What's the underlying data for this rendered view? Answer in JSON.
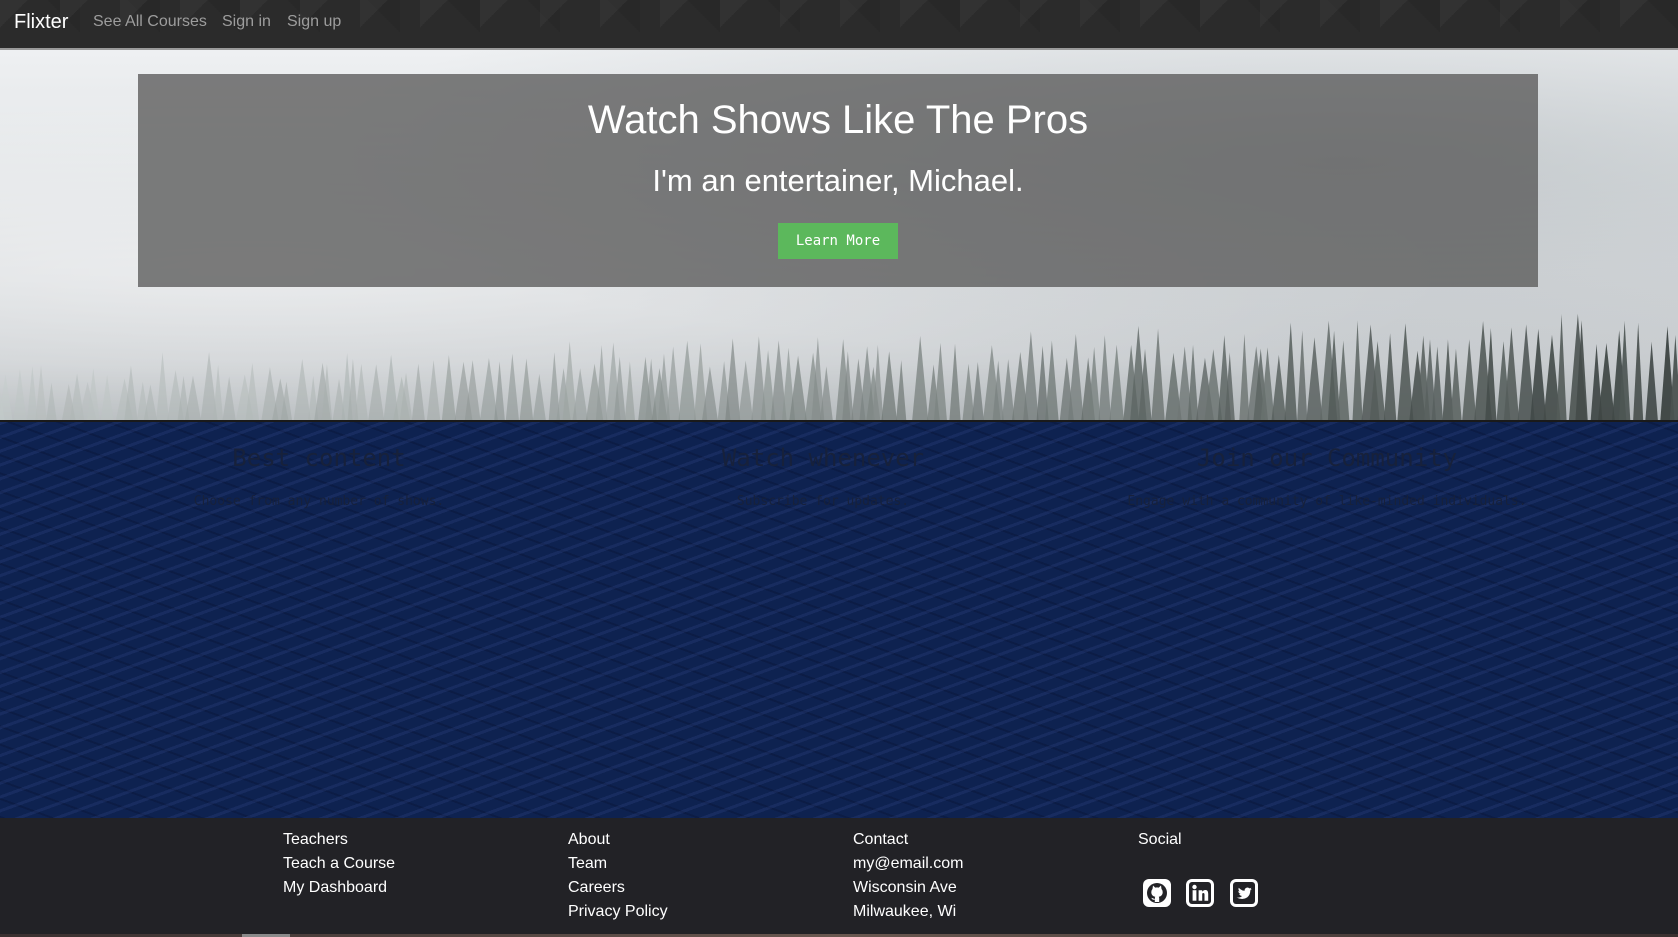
{
  "nav": {
    "brand": "Flixter",
    "links": [
      "See All Courses",
      "Sign in",
      "Sign up"
    ]
  },
  "hero": {
    "title": "Watch Shows Like The Pros",
    "subtitle": "I'm an entertainer, Michael.",
    "button_label": "Learn More"
  },
  "features": [
    {
      "title": "Best content",
      "text": "Choose from any number of shows."
    },
    {
      "title": "Watch whenever",
      "text": "Subscribe for updates."
    },
    {
      "title": "Join our Community",
      "text": "Engage with a community of like-minded individuals."
    }
  ],
  "footer": {
    "columns": [
      {
        "items": [
          "Teachers",
          "Teach a Course",
          "My Dashboard"
        ]
      },
      {
        "items": [
          "About",
          "Team",
          "Careers",
          "Privacy Policy"
        ]
      },
      {
        "items": [
          "Contact",
          "my@email.com",
          "Wisconsin Ave",
          "Milwaukee, Wi"
        ]
      },
      {
        "items": [
          "Social"
        ]
      }
    ],
    "social_icons": [
      "github-icon",
      "linkedin-icon",
      "twitter-icon"
    ]
  },
  "colors": {
    "navbar_bg": "#2b2b2b",
    "button_green": "#5cb85c",
    "features_bg": "#0e2250",
    "footer_bg": "#222226"
  }
}
